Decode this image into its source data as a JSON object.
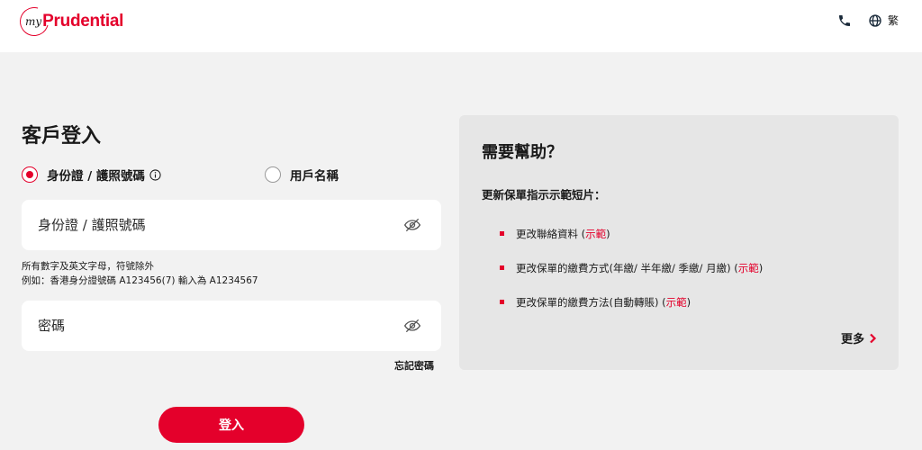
{
  "header": {
    "logo_my": "my",
    "logo_brand": "Prudential",
    "lang_label": "繁"
  },
  "login": {
    "title": "客戶登入",
    "radio_id_label": "身份證 / 護照號碼",
    "radio_username_label": "用戶名稱",
    "id_placeholder": "身份證 / 護照號碼",
    "hint_line1": "所有數字及英文字母，符號除外",
    "hint_line2": "例如：香港身分證號碼 A123456(7) 輸入為 A1234567",
    "password_placeholder": "密碼",
    "forgot_label": "忘記密碼",
    "login_button": "登入"
  },
  "help": {
    "title": "需要幫助？",
    "subtitle": "更新保單指示示範短片：",
    "items": [
      {
        "text": "更改聯絡資料 (",
        "link": "示範",
        "tail": ")"
      },
      {
        "text": "更改保單的繳費方式(年繳/ 半年繳/ 季繳/ 月繳)  (",
        "link": "示範",
        "tail": ")"
      },
      {
        "text": "更改保單的繳費方法(自動轉賬)  (",
        "link": "示範",
        "tail": ")"
      }
    ],
    "more_label": "更多"
  },
  "colors": {
    "brand_red": "#e4002b",
    "page_bg": "#f2f2f2",
    "panel_bg": "#e6e6e6"
  }
}
